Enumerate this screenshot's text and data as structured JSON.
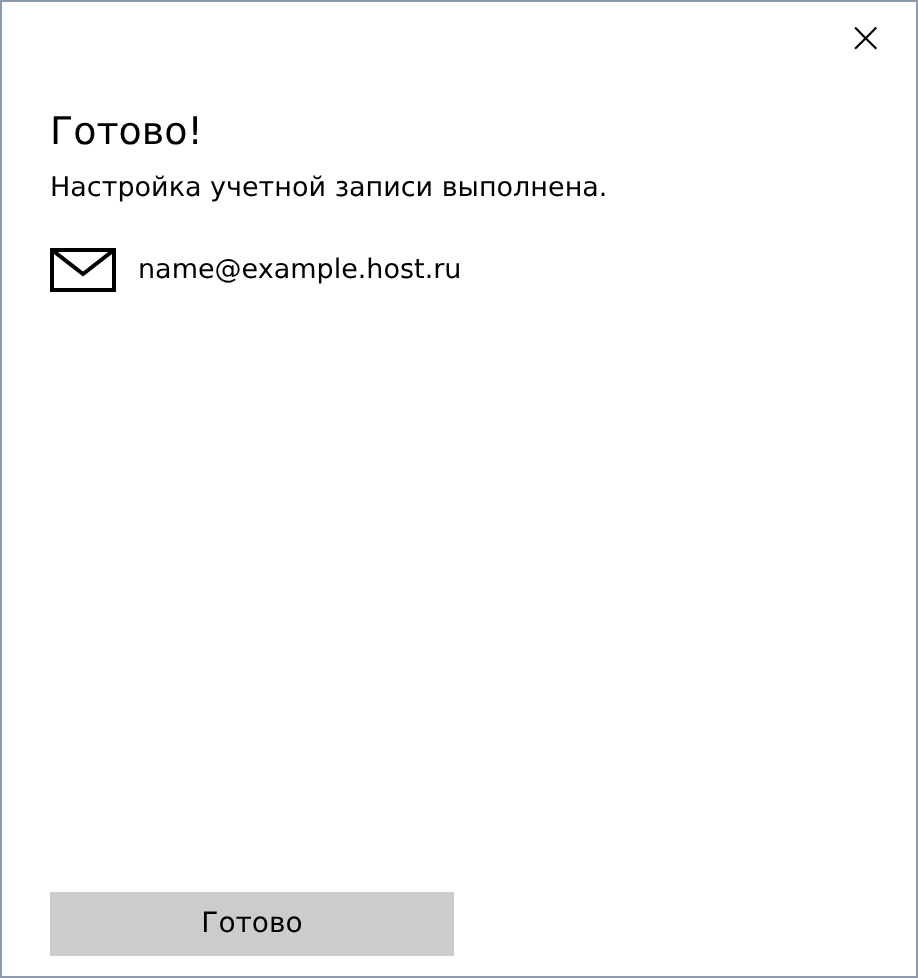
{
  "window": {
    "close": "×"
  },
  "title": "Готово!",
  "message": "Настройка учетной записи выполнена.",
  "account": {
    "email": "name@example.host.ru"
  },
  "buttons": [
    {
      "label": "Готово"
    }
  ]
}
